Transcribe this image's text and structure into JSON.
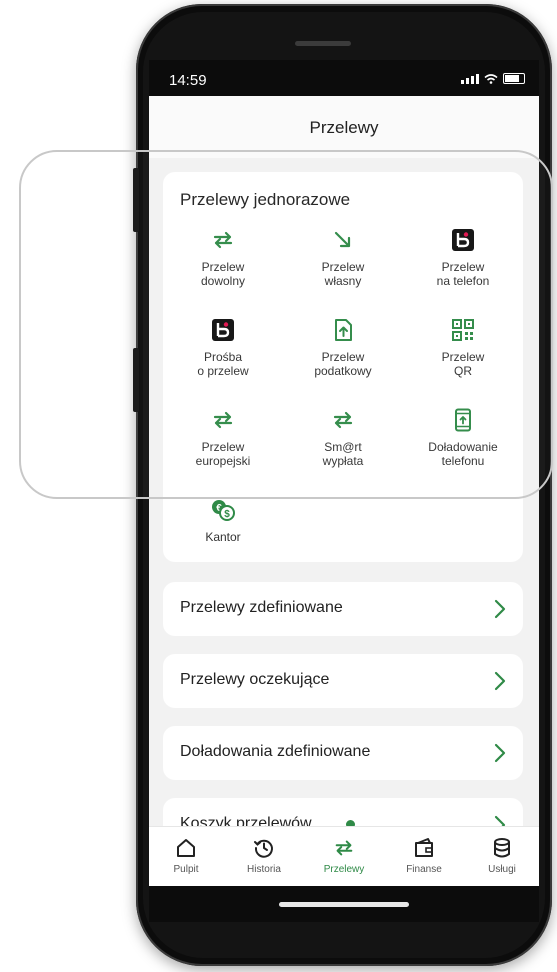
{
  "colors": {
    "accent": "#2f8a47",
    "text": "#222222",
    "background": "#f2f2f2"
  },
  "status_bar": {
    "time": "14:59"
  },
  "header": {
    "title": "Przelewy"
  },
  "jednorazowe": {
    "title": "Przelewy jednorazowe",
    "tiles": [
      {
        "label": "Przelew\ndowolny",
        "icon": "transfer-arrows-icon"
      },
      {
        "label": "Przelew\nwłasny",
        "icon": "diagonal-arrow-icon"
      },
      {
        "label": "Przelew\nna telefon",
        "icon": "blik-icon"
      },
      {
        "label": "Prośba\no przelew",
        "icon": "blik-icon"
      },
      {
        "label": "Przelew\npodatkowy",
        "icon": "tax-document-icon"
      },
      {
        "label": "Przelew\nQR",
        "icon": "qr-code-icon"
      },
      {
        "label": "Przelew\neuropejski",
        "icon": "transfer-arrows-icon"
      },
      {
        "label": "Sm@rt\nwypłata",
        "icon": "transfer-arrows-icon"
      },
      {
        "label": "Doładowanie\ntelefonu",
        "icon": "phone-topup-icon"
      },
      {
        "label": "Kantor",
        "icon": "currency-exchange-icon"
      }
    ]
  },
  "menu_rows": [
    {
      "label": "Przelewy zdefiniowane"
    },
    {
      "label": "Przelewy oczekujące"
    },
    {
      "label": "Doładowania zdefiniowane"
    },
    {
      "label": "Koszyk przelewów"
    }
  ],
  "tabbar": {
    "items": [
      {
        "label": "Pulpit",
        "icon": "home-icon"
      },
      {
        "label": "Historia",
        "icon": "history-icon"
      },
      {
        "label": "Przelewy",
        "icon": "transfer-arrows-icon",
        "active": true
      },
      {
        "label": "Finanse",
        "icon": "wallet-icon"
      },
      {
        "label": "Usługi",
        "icon": "database-icon"
      }
    ]
  }
}
